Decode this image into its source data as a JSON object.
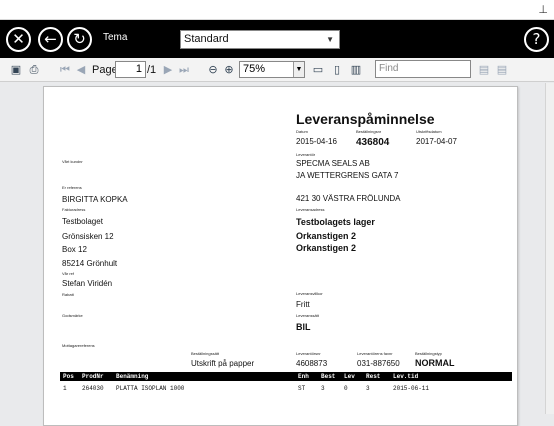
{
  "appbar": {
    "close_glyph": "✕",
    "back_glyph": "←",
    "refresh_glyph": "↻",
    "tema_label": "Tema",
    "tema_value": "Standard",
    "help_glyph": "?"
  },
  "toolbar": {
    "page_label": "Page",
    "page_value": "1",
    "page_total": "/1",
    "zoom_value": "75%",
    "find_placeholder": "Find"
  },
  "document": {
    "title": "Leveranspåminnelse",
    "datum_label": "Datum",
    "datum": "2015-04-16",
    "bestnr_label": "Beställningsnr",
    "bestnr": "436804",
    "utskrift_label": "Utskriftsdatum",
    "utskrift": "2017-04-07",
    "levnr_label": "Leverantör",
    "leverantor_1": "SPECMA SEALS AB",
    "leverantor_2": "JA WETTERGRENS GATA 7",
    "leverantor_3": "421 30 VÄSTRA FRÖLUNDA",
    "kundnr_label": "Vårt kundnr",
    "er_ref_label": "Er referens",
    "er_ref": "BIRGITTA KOPKA",
    "faktura_label": "Fakturadress",
    "faktura_1": "Testbolaget",
    "faktura_2": "Grönsisken 12",
    "faktura_3": "Box 12",
    "faktura_4": "85214 Grönhult",
    "leveransadress_label": "Leveransadress",
    "leveransadress_1": "Testbolagets lager",
    "leveransadress_2": "Orkanstigen 2",
    "leveransadress_3": "Orkanstigen 2",
    "var_ref_label": "Vår ref",
    "var_ref": "Stefan Viridén",
    "rabatt_label": "Rabatt",
    "villkor_label": "Leveransvillkor",
    "villkor": "Fritt",
    "godsmarke_label": "Godsmärke",
    "leveranssatt_label": "Leveranssätt",
    "leveranssatt": "BIL",
    "mottagare_label": "Mottagarereferens",
    "bestsatt_label": "Beställningssätt",
    "bestsatt": "Utskrift på papper",
    "levnr2_label": "Leverantörsnr",
    "levnr2": "4608873",
    "fax_label": "Leverantörens faxnr",
    "fax": "031-887650",
    "besttyp_label": "Beställningstyp",
    "besttyp": "NORMAL"
  },
  "table": {
    "headers": [
      "Pos",
      "ProdNr",
      "Benämning",
      "Enh",
      "Best",
      "Lev",
      "Rest",
      "Lev.tid"
    ],
    "rows": [
      [
        "1",
        "264030",
        "PLATTA ISOPLAN 1000",
        "ST",
        "3",
        "0",
        "3",
        "2015-06-11"
      ]
    ]
  }
}
